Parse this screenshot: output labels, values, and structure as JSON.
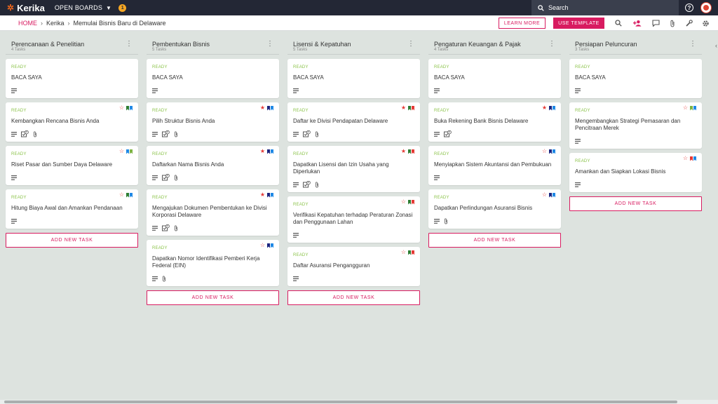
{
  "app": {
    "name": "Kerika",
    "open_boards_label": "OPEN BOARDS",
    "notif_count": "1",
    "search_placeholder": "Search",
    "help_symbol": "?"
  },
  "breadcrumb": {
    "home": "HOME",
    "items": [
      "Kerika",
      "Memulai Bisnis Baru di Delaware"
    ]
  },
  "toolbar": {
    "learn_more": "LEARN MORE",
    "use_template": "USE TEMPLATE"
  },
  "colors": {
    "accent": "#d81b60",
    "ready": "#8bc34a",
    "star": "#e53935",
    "green": "#2e7d32",
    "blue": "#1e88e5",
    "red": "#e53935",
    "navy": "#1a237e",
    "lightgreen": "#7cb342"
  },
  "add_task_label": "ADD NEW TASK",
  "columns": [
    {
      "title": "Perencanaan & Penelitian",
      "count": "4 Tasks",
      "cards": [
        {
          "status": "READY",
          "title": "BACA SAYA",
          "desc": true
        },
        {
          "status": "READY",
          "title": "Kembangkan Rencana Bisnis Anda",
          "desc": true,
          "checklist": "4",
          "attach": true,
          "star": "outline",
          "bookmarks": [
            "green",
            "blue"
          ]
        },
        {
          "status": "READY",
          "title": "Riset Pasar dan Sumber Daya Delaware",
          "desc": true,
          "star": "outline",
          "bookmarks": [
            "blue",
            "lightgreen"
          ]
        },
        {
          "status": "READY",
          "title": "Hitung Biaya Awal dan Amankan Pendanaan",
          "desc": true,
          "star": "outline",
          "bookmarks": [
            "green",
            "blue"
          ]
        }
      ]
    },
    {
      "title": "Pembentukan Bisnis",
      "count": "5 Tasks",
      "cards": [
        {
          "status": "READY",
          "title": "BACA SAYA",
          "desc": true
        },
        {
          "status": "READY",
          "title": "Pilih Struktur Bisnis Anda",
          "desc": true,
          "checklist": "4",
          "attach": true,
          "star": "filled",
          "bookmarks": [
            "navy",
            "blue"
          ]
        },
        {
          "status": "READY",
          "title": "Daftarkan Nama Bisnis Anda",
          "desc": true,
          "checklist": "4",
          "attach": true,
          "star": "filled",
          "bookmarks": [
            "navy",
            "blue"
          ]
        },
        {
          "status": "READY",
          "title": "Mengajukan Dokumen Pembentukan ke Divisi Korporasi Delaware",
          "desc": true,
          "checklist": "4",
          "attach": true,
          "star": "filled",
          "bookmarks": [
            "navy",
            "blue"
          ]
        },
        {
          "status": "READY",
          "title": "Dapatkan Nomor Identifikasi Pemberi Kerja Federal (EIN)",
          "desc": true,
          "attach": true,
          "star": "outline",
          "bookmarks": [
            "navy",
            "blue"
          ]
        }
      ]
    },
    {
      "title": "Lisensi & Kepatuhan",
      "count": "5 Tasks",
      "cards": [
        {
          "status": "READY",
          "title": "BACA SAYA",
          "desc": true
        },
        {
          "status": "READY",
          "title": "Daftar ke Divisi Pendapatan Delaware",
          "desc": true,
          "checklist": "4",
          "attach": true,
          "star": "filled",
          "bookmarks": [
            "green",
            "red"
          ]
        },
        {
          "status": "READY",
          "title": "Dapatkan Lisensi dan Izin Usaha yang Diperlukan",
          "desc": true,
          "checklist": "4",
          "attach": true,
          "star": "filled",
          "bookmarks": [
            "green",
            "red"
          ]
        },
        {
          "status": "READY",
          "title": "Verifikasi Kepatuhan terhadap Peraturan Zonasi dan Penggunaan Lahan",
          "desc": true,
          "star": "outline",
          "bookmarks": [
            "green",
            "red"
          ]
        },
        {
          "status": "READY",
          "title": "Daftar Asuransi Pengangguran",
          "desc": true,
          "star": "outline",
          "bookmarks": [
            "green",
            "red"
          ]
        }
      ]
    },
    {
      "title": "Pengaturan Keuangan & Pajak",
      "count": "4 Tasks",
      "cards": [
        {
          "status": "READY",
          "title": "BACA SAYA",
          "desc": true
        },
        {
          "status": "READY",
          "title": "Buka Rekening Bank Bisnis Delaware",
          "desc": true,
          "checklist": "4",
          "star": "filled",
          "bookmarks": [
            "navy",
            "blue"
          ]
        },
        {
          "status": "READY",
          "title": "Menyiapkan Sistem Akuntansi dan Pembukuan",
          "desc": true,
          "star": "outline",
          "bookmarks": [
            "navy",
            "blue"
          ]
        },
        {
          "status": "READY",
          "title": "Dapatkan Perlindungan Asuransi Bisnis",
          "desc": true,
          "attach": true,
          "star": "outline",
          "bookmarks": [
            "navy",
            "blue"
          ]
        }
      ]
    },
    {
      "title": "Persiapan Peluncuran",
      "count": "3 Tasks",
      "cards": [
        {
          "status": "READY",
          "title": "BACA SAYA",
          "desc": true
        },
        {
          "status": "READY",
          "title": "Mengembangkan Strategi Pemasaran dan Pencitraan Merek",
          "desc": true,
          "star": "outline",
          "bookmarks": [
            "lightgreen",
            "blue"
          ]
        },
        {
          "status": "READY",
          "title": "Amankan dan Siapkan Lokasi Bisnis",
          "desc": true,
          "star": "outline",
          "bookmarks": [
            "red",
            "blue"
          ]
        }
      ]
    }
  ]
}
